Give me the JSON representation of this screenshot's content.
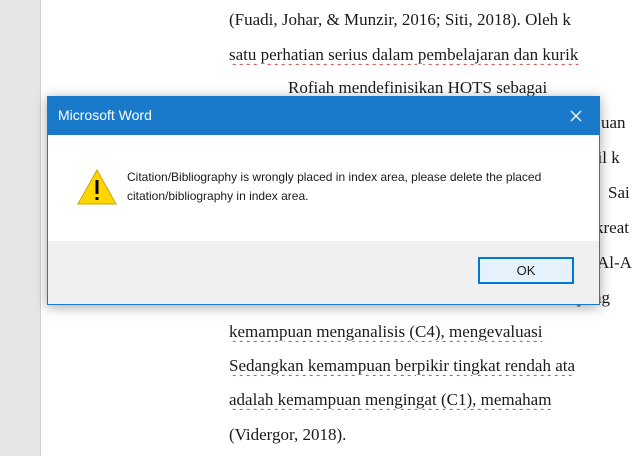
{
  "document": {
    "lines": [
      {
        "text": "(Fuadi, Johar, & Munzir, 2016; Siti, 2018). Oleh k"
      },
      {
        "text": "satu perhatian serius dalam pembelajaran dan kurik"
      },
      {
        "text": "Rofiah mendefinisikan HOTS sebagai"
      },
      {
        "text": "uan"
      },
      {
        "text": "bil k"
      },
      {
        "text": "Sai"
      },
      {
        "text": "kreat"
      },
      {
        "text": "Al-A"
      },
      {
        "text": "yang"
      },
      {
        "text": "kemampuan menganalisis (C4), mengevaluasi"
      },
      {
        "text": "Sedangkan kemampuan berpikir tingkat rendah ata"
      },
      {
        "text": "adalah kemampuan mengingat (C1), memaham"
      },
      {
        "text": "(Vidergor, 2018)."
      }
    ]
  },
  "dialog": {
    "title": "Microsoft Word",
    "close_symbol": "✕",
    "message": "Citation/Bibliography is wrongly placed in index area, please delete the placed citation/bibliography in index area.",
    "ok_label": "OK"
  },
  "colors": {
    "titlebar": "#1979ca",
    "warning_fill": "#ffd500",
    "ok_border": "#0078d7"
  }
}
